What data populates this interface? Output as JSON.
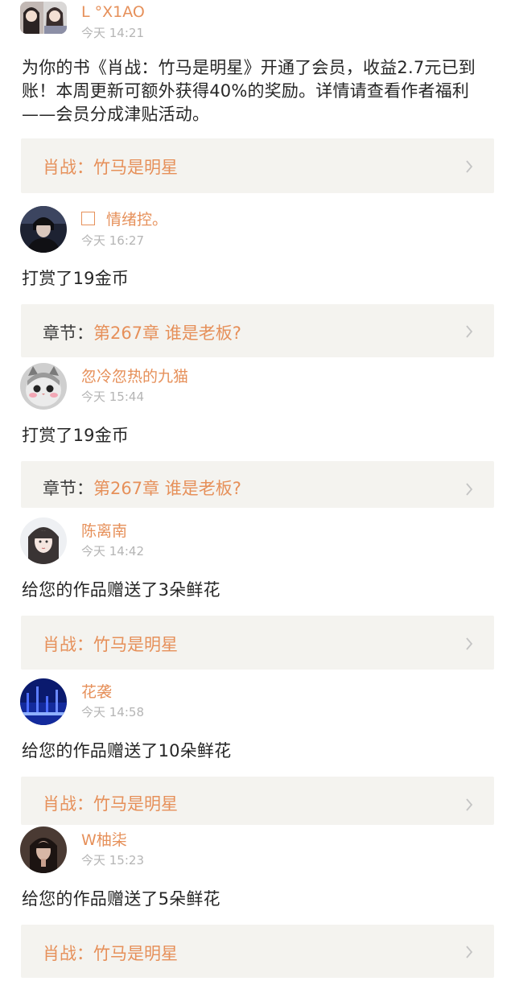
{
  "posts": [
    {
      "username": "L °X1AO",
      "time": "今天 14:21",
      "message": "为你的书《肖战：竹马是明星》开通了会员，收益2.7元已到账！本周更新可额外获得40%的奖励。详情请查看作者福利——会员分成津贴活动。",
      "card": {
        "prefix": "",
        "title": "肖战：竹马是明星"
      }
    },
    {
      "username": "情绪控。",
      "time": "今天 16:27",
      "message": "打赏了19金币",
      "card": {
        "prefix": "章节：",
        "title": "第267章 谁是老板?"
      }
    },
    {
      "username": "忽冷忽热的九猫",
      "time": "今天 15:44",
      "message": "打赏了19金币",
      "card": {
        "prefix": "章节：",
        "title": "第267章 谁是老板?"
      }
    },
    {
      "username": "陈离南",
      "time": "今天 14:42",
      "message": "给您的作品赠送了3朵鲜花",
      "card": {
        "prefix": "",
        "title": "肖战：竹马是明星"
      }
    },
    {
      "username": "花袭",
      "time": "今天 14:58",
      "message": "给您的作品赠送了10朵鲜花",
      "card": {
        "prefix": "",
        "title": "肖战：竹马是明星"
      }
    },
    {
      "username": "W柚柒",
      "time": "今天 15:23",
      "message": "给您的作品赠送了5朵鲜花",
      "card": {
        "prefix": "",
        "title": "肖战：竹马是明星"
      }
    }
  ],
  "icons": {
    "card_arrow": "chevron-right-icon",
    "name_prefix": "square-icon"
  },
  "colors": {
    "accent": "#e6905a",
    "card_background": "#f4f3ef",
    "timestamp": "#b5b5b5",
    "body_text": "#262626"
  }
}
